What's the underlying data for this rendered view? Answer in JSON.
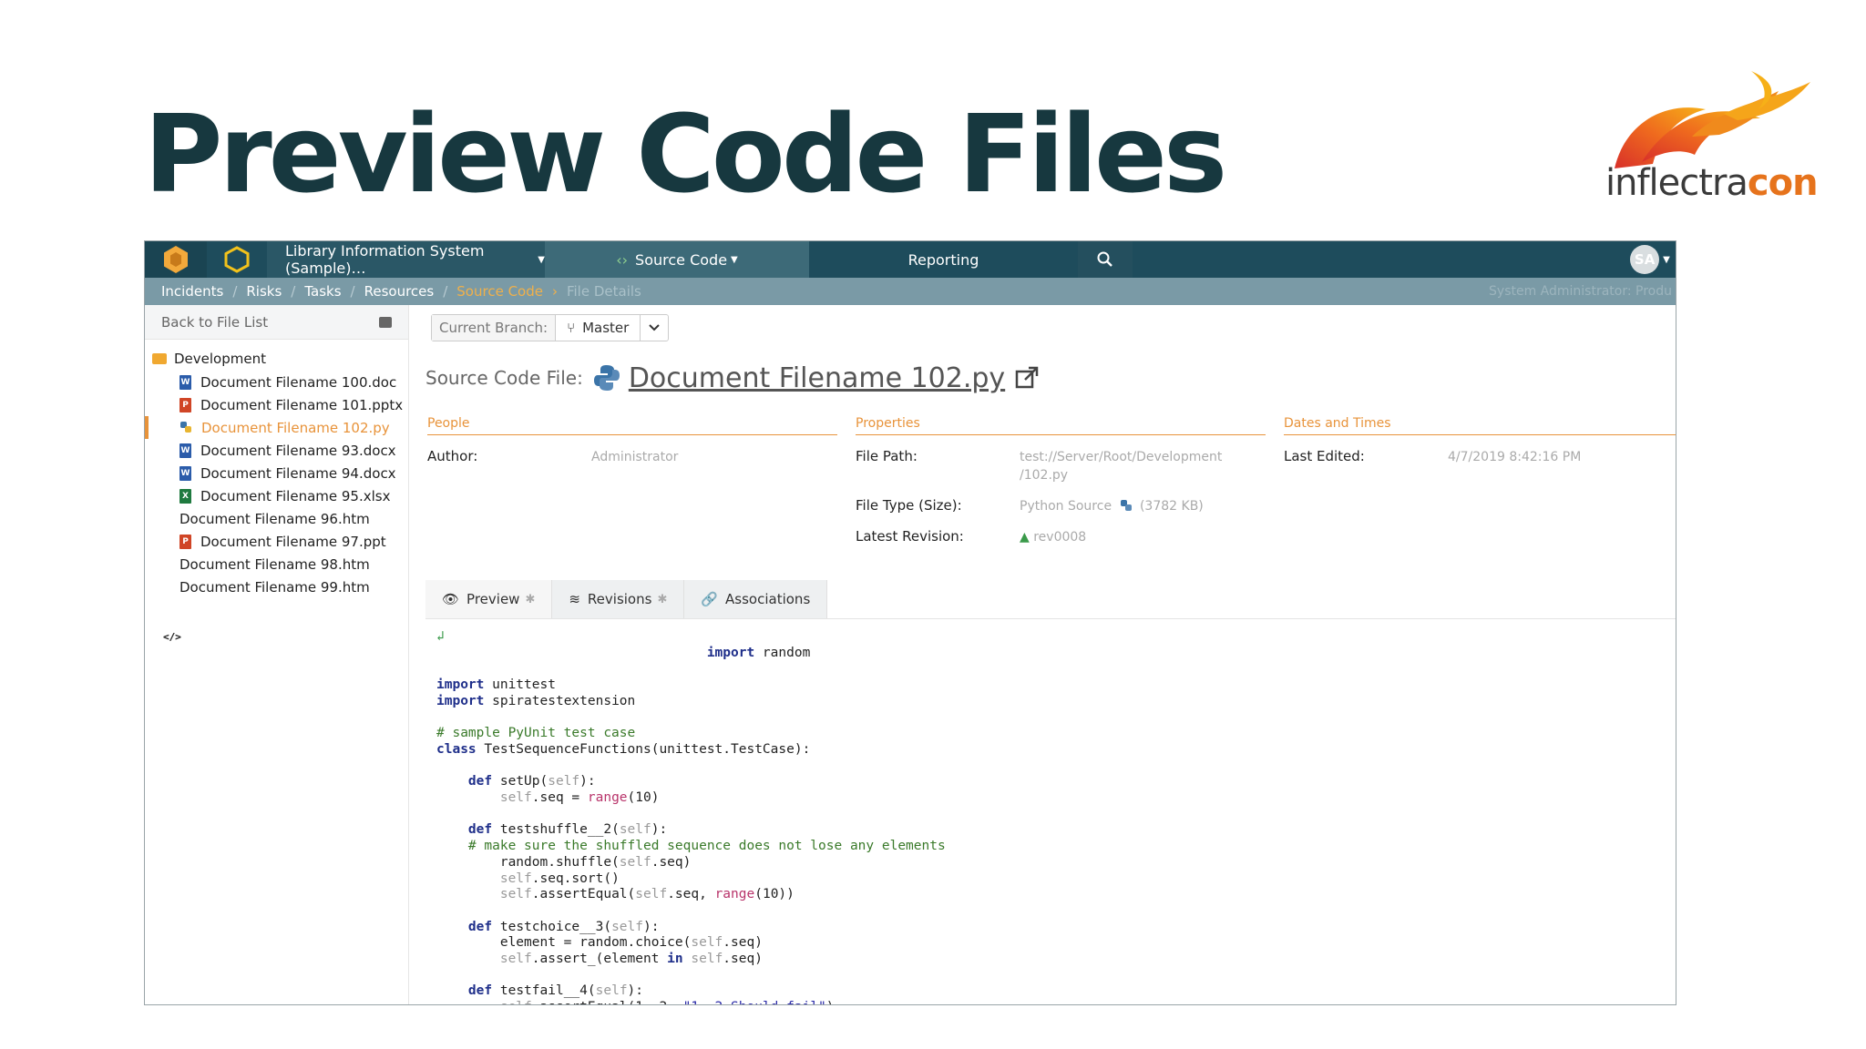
{
  "slide": {
    "title": "Preview Code Files"
  },
  "logo": {
    "text_main": "inflectra",
    "text_accent": "con"
  },
  "topbar": {
    "project": "Library Information System (Sample)…",
    "source_code": "Source Code",
    "reporting": "Reporting",
    "avatar_initials": "SA"
  },
  "subnav": {
    "items": [
      "Incidents",
      "Risks",
      "Tasks",
      "Resources"
    ],
    "active": "Source Code",
    "current": "File Details",
    "right": "System Administrator: Produ"
  },
  "sidebar": {
    "back": "Back to File List",
    "folder": "Development",
    "files": [
      {
        "name": "Document Filename 100.doc",
        "type": "doc"
      },
      {
        "name": "Document Filename 101.pptx",
        "type": "ppt"
      },
      {
        "name": "Document Filename 102.py",
        "type": "py"
      },
      {
        "name": "Document Filename 93.docx",
        "type": "doc"
      },
      {
        "name": "Document Filename 94.docx",
        "type": "doc"
      },
      {
        "name": "Document Filename 95.xlsx",
        "type": "xls"
      },
      {
        "name": "Document Filename 96.htm",
        "type": "code"
      },
      {
        "name": "Document Filename 97.ppt",
        "type": "ppt"
      },
      {
        "name": "Document Filename 98.htm",
        "type": "code"
      },
      {
        "name": "Document Filename 99.htm",
        "type": "code"
      }
    ]
  },
  "branch": {
    "label": "Current Branch:",
    "value": "Master"
  },
  "file": {
    "label": "Source Code File:",
    "name": "Document Filename 102.py"
  },
  "people": {
    "heading": "People",
    "author_label": "Author:",
    "author_value": "Administrator"
  },
  "properties": {
    "heading": "Properties",
    "path_label": "File Path:",
    "path_line1": "test://Server/Root/Development",
    "path_line2": "/102.py",
    "type_label": "File Type (Size):",
    "type_value": "Python Source",
    "size_value": "(3782 KB)",
    "rev_label": "Latest Revision:",
    "rev_value": "rev0008"
  },
  "dates": {
    "heading": "Dates and Times",
    "edited_label": "Last Edited:",
    "edited_value": "4/7/2019 8:42:16 PM"
  },
  "tabs": {
    "preview": "Preview",
    "revisions": "Revisions",
    "associations": "Associations"
  }
}
